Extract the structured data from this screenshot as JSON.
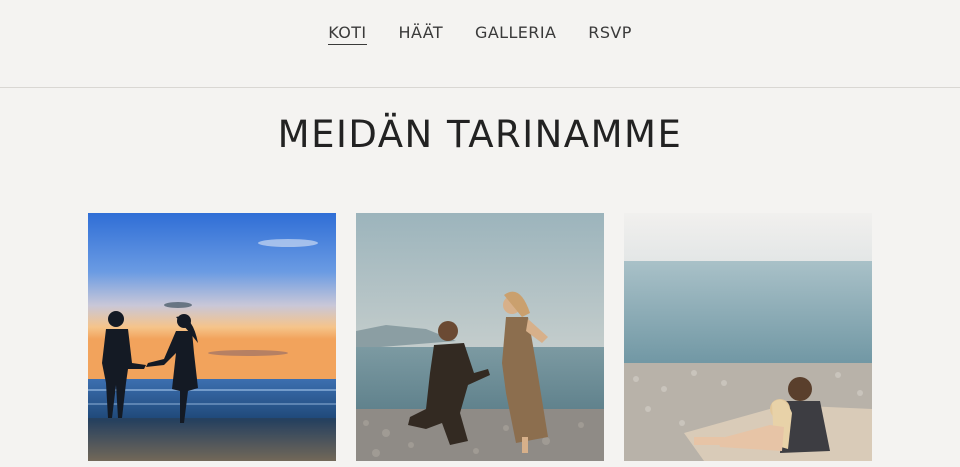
{
  "nav": {
    "items": [
      {
        "label": "KOTI",
        "active": true
      },
      {
        "label": "HÄÄT",
        "active": false
      },
      {
        "label": "GALLERIA",
        "active": false
      },
      {
        "label": "RSVP",
        "active": false
      }
    ]
  },
  "main": {
    "title": "MEIDÄN TARINAMME"
  },
  "colors": {
    "background": "#f4f3f1",
    "text": "#2b2b2b",
    "divider": "#d9d7d3"
  }
}
